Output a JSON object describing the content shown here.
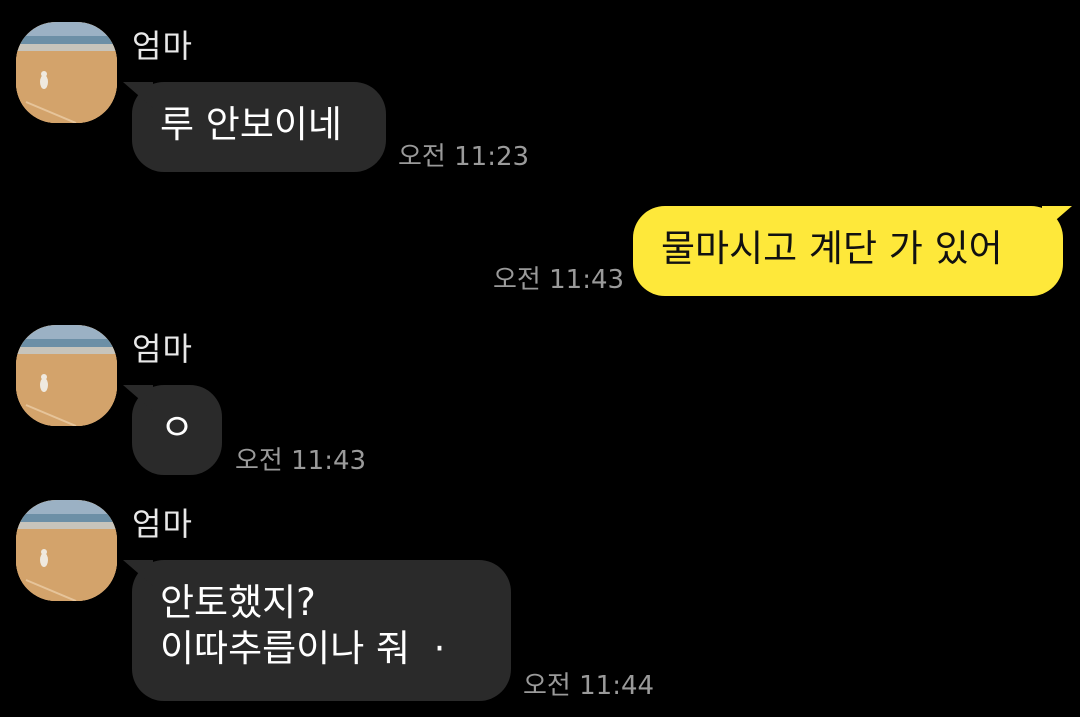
{
  "messages": [
    {
      "sender": "엄마",
      "text": "루 안보이네",
      "time": "오전 11:23"
    },
    {
      "text": "물마시고 계단 가 있어",
      "time": "오전 11:43"
    },
    {
      "sender": "엄마",
      "text": "ㅇ",
      "time": "오전 11:43"
    },
    {
      "sender": "엄마",
      "text": "안토했지?\n이따추릅이나 줘  ·",
      "time": "오전 11:44"
    }
  ],
  "colors": {
    "background": "#000000",
    "incoming_bubble": "#2a2a2a",
    "outgoing_bubble": "#fee83a",
    "timestamp": "#9a9a9a"
  },
  "icons": {
    "avatar": "beach-photo-avatar"
  }
}
